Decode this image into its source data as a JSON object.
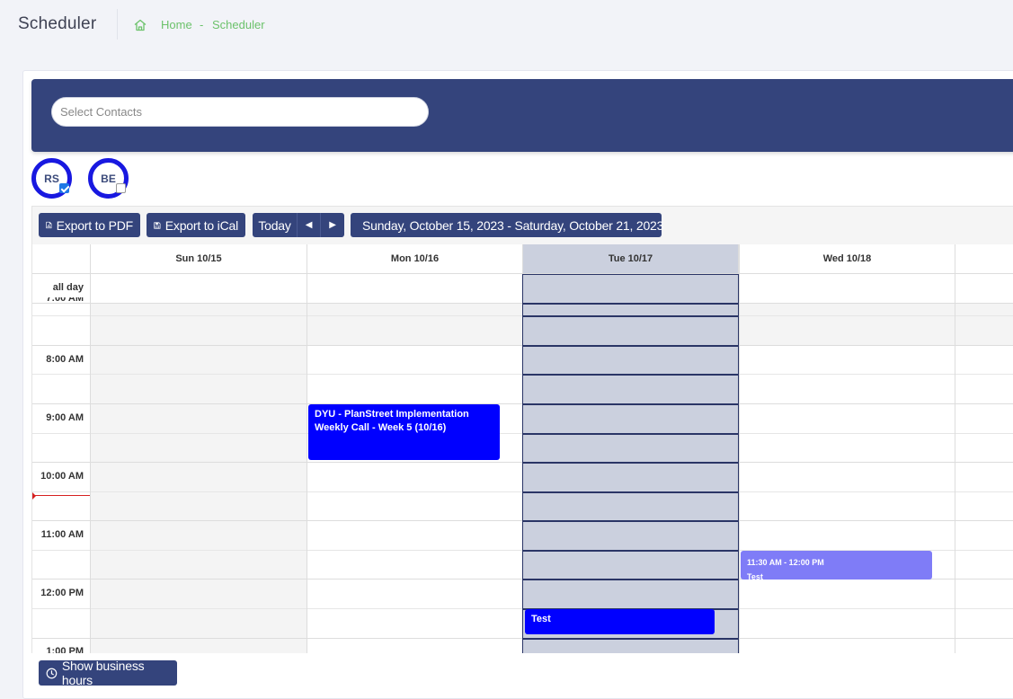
{
  "header": {
    "title": "Scheduler",
    "breadcrumb": {
      "home": "Home",
      "separator": "-",
      "current": "Scheduler"
    }
  },
  "contacts": {
    "placeholder": "Select Contacts"
  },
  "avatars": [
    {
      "initials": "RS",
      "checked": true
    },
    {
      "initials": "BE",
      "checked": false
    }
  ],
  "toolbar": {
    "export_pdf": "Export to PDF",
    "export_ical": "Export to iCal",
    "today": "Today",
    "date_range": "Sunday, October 15, 2023 - Saturday, October 21, 2023"
  },
  "calendar": {
    "columns": [
      "Sun 10/15",
      "Mon 10/16",
      "Tue 10/17",
      "Wed 10/18"
    ],
    "all_day_label": "all day",
    "partial_top_label": "7:00 AM",
    "time_labels": [
      "8:00 AM",
      "9:00 AM",
      "10:00 AM",
      "11:00 AM",
      "12:00 PM",
      "1:00 PM"
    ],
    "events": [
      {
        "day": "Mon 10/16",
        "title": "DYU - PlanStreet Implementation Weekly Call - Week 5 (10/16)",
        "color": "#0000ff"
      },
      {
        "day": "Tue 10/17",
        "title": "Test",
        "color": "#0000ff"
      },
      {
        "day": "Wed 10/18",
        "time": "11:30 AM - 12:00 PM",
        "title": "Test",
        "color": "#7f7cf7"
      }
    ]
  },
  "footer": {
    "business_hours": "Show business hours"
  },
  "colors": {
    "brand": "#34447c",
    "accent_blue": "#0000ff",
    "link_green": "#6cc26b",
    "selected_day": "#cbd0de"
  }
}
